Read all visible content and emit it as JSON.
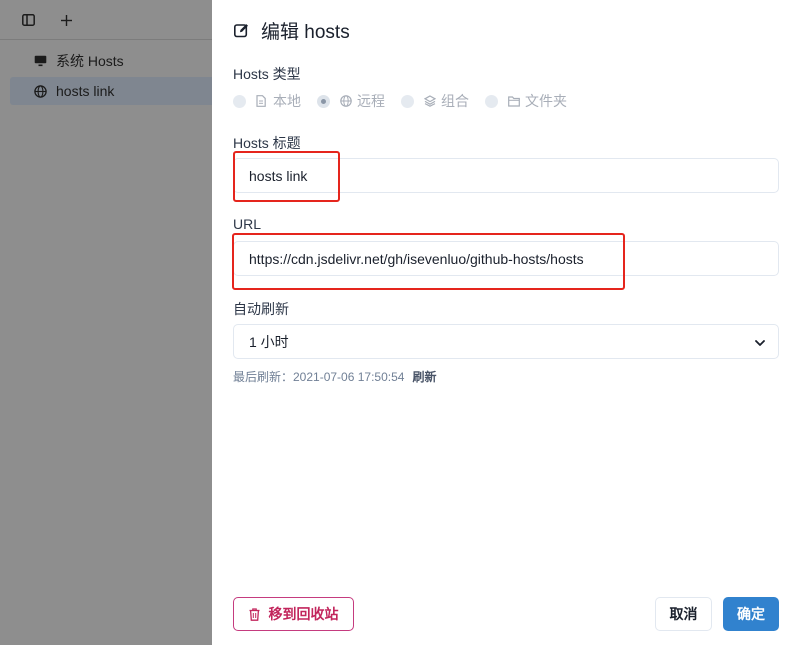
{
  "sidebar": {
    "items": [
      {
        "label": "系统 Hosts",
        "icon": "monitor-icon"
      },
      {
        "label": "hosts link",
        "icon": "globe-icon",
        "active": true
      }
    ]
  },
  "drawer": {
    "title": "编辑 hosts",
    "type_label": "Hosts 类型",
    "type_options": [
      {
        "label": "本地",
        "icon": "file-icon",
        "checked": false
      },
      {
        "label": "远程",
        "icon": "globe-icon",
        "checked": true
      },
      {
        "label": "组合",
        "icon": "layers-icon",
        "checked": false
      },
      {
        "label": "文件夹",
        "icon": "folder-icon",
        "checked": false
      }
    ],
    "title_label": "Hosts 标题",
    "title_value": "hosts link",
    "url_label": "URL",
    "url_value": "https://cdn.jsdelivr.net/gh/isevenluo/github-hosts/hosts",
    "refresh_label": "自动刷新",
    "refresh_value": "1 小时",
    "last_refresh_text": "最后刷新：2021-07-06 17:50:54",
    "refresh_button": "刷新",
    "trash_button": "移到回收站",
    "cancel_button": "取消",
    "ok_button": "确定"
  },
  "colors": {
    "accent": "#3182ce",
    "danger": "#c2255c",
    "highlight_box": "#e5251d"
  }
}
